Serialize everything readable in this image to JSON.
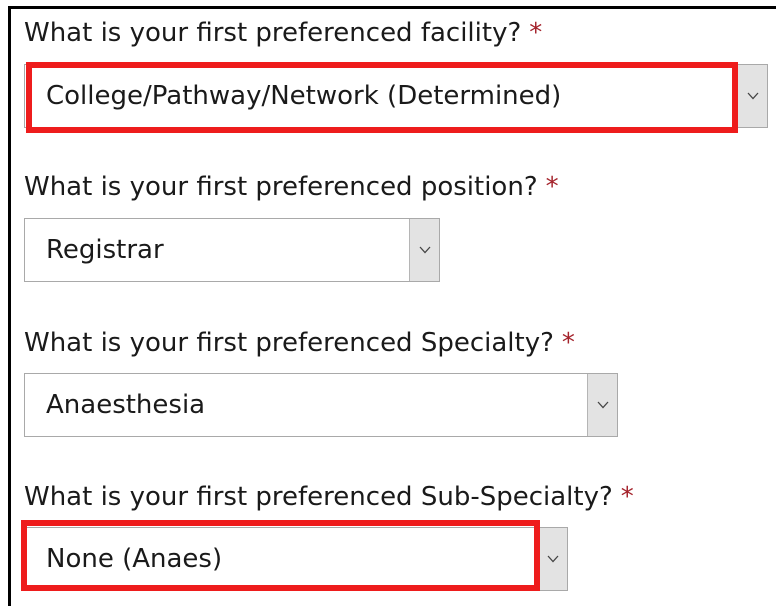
{
  "fields": [
    {
      "label": "What is your first preferenced facility?",
      "required_mark": "*",
      "selected": "College/Pathway/Network (Determined)",
      "highlighted": true
    },
    {
      "label": "What is your first preferenced position?",
      "required_mark": "*",
      "selected": "Registrar",
      "highlighted": false
    },
    {
      "label": "What is your first preferenced Specialty?",
      "required_mark": "*",
      "selected": "Anaesthesia",
      "highlighted": false
    },
    {
      "label": "What is your first preferenced Sub-Specialty?",
      "required_mark": "*",
      "selected": "None (Anaes)",
      "highlighted": true
    }
  ],
  "colors": {
    "required": "#a4222b",
    "highlight": "#ee1c1c",
    "arrow_bg": "#e3e3e3"
  },
  "icons": {
    "dropdown": "chevron-down-icon"
  }
}
